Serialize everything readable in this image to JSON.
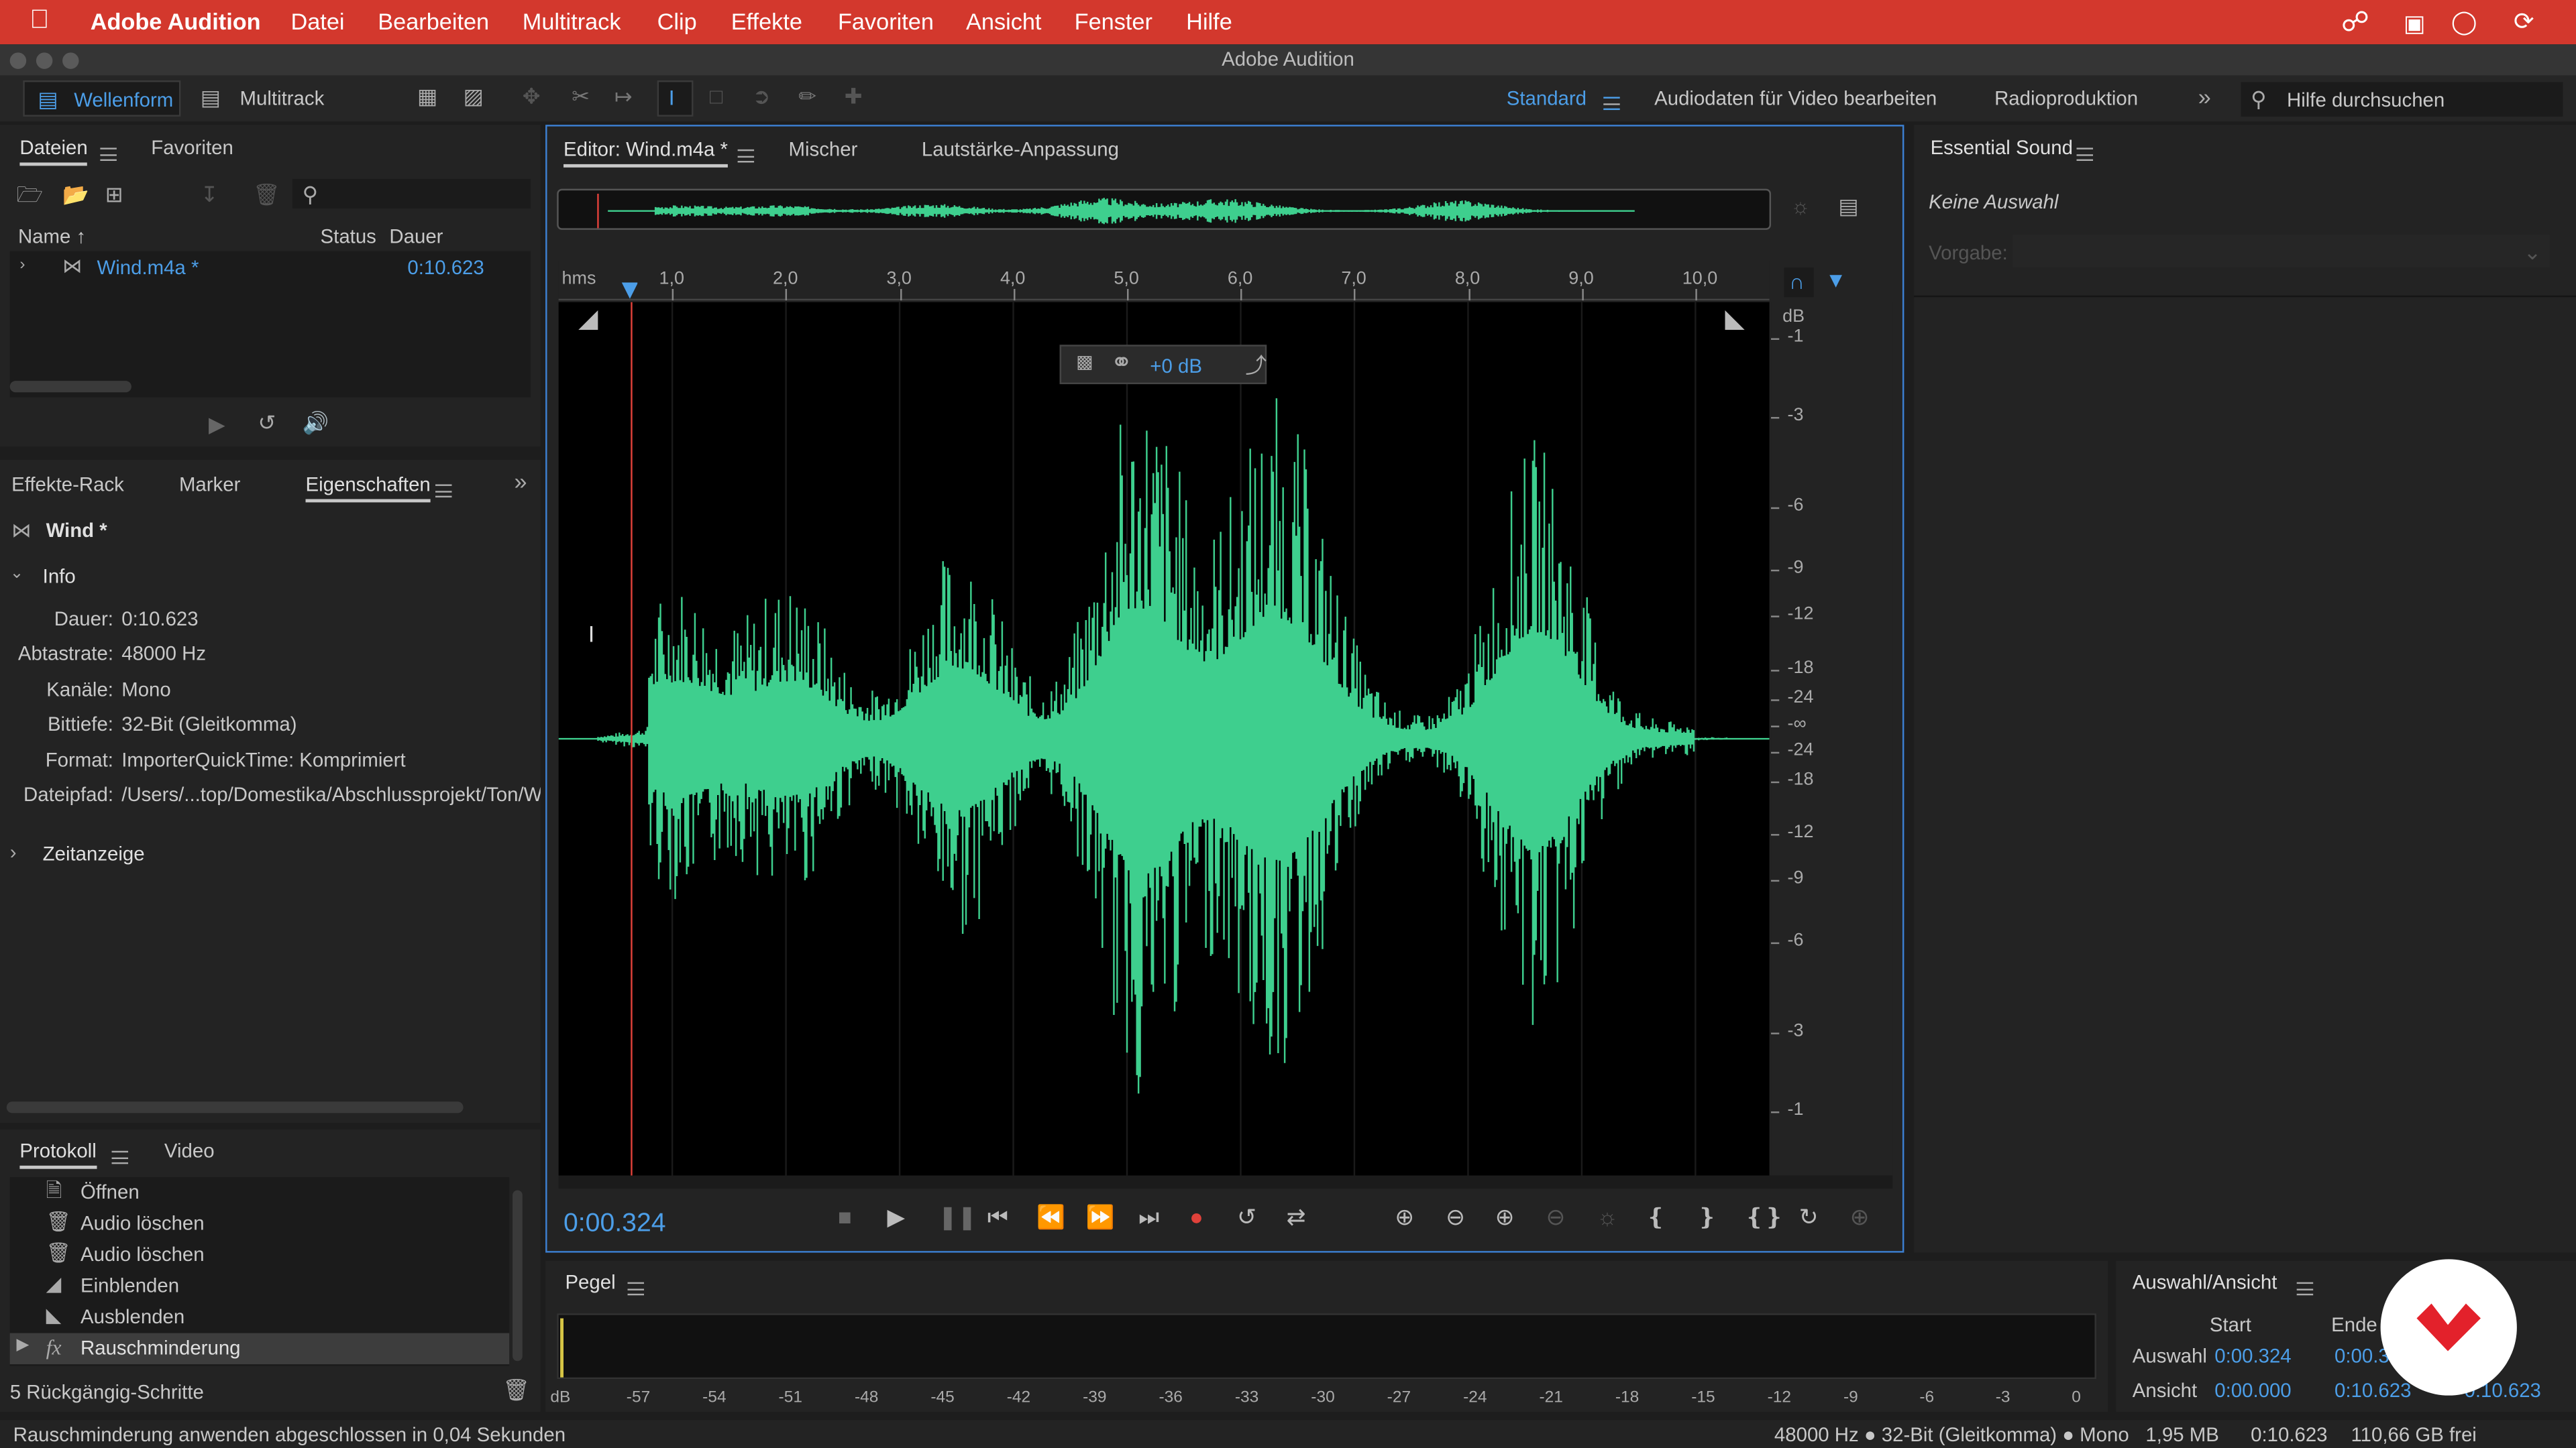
{
  "menubar": {
    "app_name": "Adobe Audition",
    "items": [
      "Datei",
      "Bearbeiten",
      "Multitrack",
      "Clip",
      "Effekte",
      "Favoriten",
      "Ansicht",
      "Fenster",
      "Hilfe"
    ]
  },
  "window": {
    "title": "Adobe Audition"
  },
  "toolbar": {
    "waveform_label": "Wellenform",
    "multitrack_label": "Multitrack",
    "workspaces": [
      "Standard",
      "Audiodaten für Video bearbeiten",
      "Radioproduktion"
    ],
    "search_placeholder": "Hilfe durchsuchen"
  },
  "files_panel": {
    "tabs": [
      "Dateien",
      "Favoriten"
    ],
    "columns": {
      "name": "Name ↑",
      "status": "Status",
      "duration": "Dauer"
    },
    "files": [
      {
        "name": "Wind.m4a *",
        "duration": "0:10.623"
      }
    ]
  },
  "properties_panel": {
    "tabs": [
      "Effekte-Rack",
      "Marker",
      "Eigenschaften"
    ],
    "file_title": "Wind *",
    "info_section": "Info",
    "info": [
      {
        "label": "Dauer:",
        "value": "0:10.623"
      },
      {
        "label": "Abtastrate:",
        "value": "48000 Hz"
      },
      {
        "label": "Kanäle:",
        "value": "Mono"
      },
      {
        "label": "Bittiefe:",
        "value": "32-Bit (Gleitkomma)"
      },
      {
        "label": "Format:",
        "value": "ImporterQuickTime: Komprimiert"
      },
      {
        "label": "Dateipfad:",
        "value": "/Users/...top/Domestika/Abschlussprojekt/Ton/Win"
      }
    ],
    "time_section": "Zeitanzeige"
  },
  "history_panel": {
    "tabs": [
      "Protokoll",
      "Video"
    ],
    "items": [
      {
        "icon": "open-icon",
        "label": "Öffnen"
      },
      {
        "icon": "trash-icon",
        "label": "Audio löschen"
      },
      {
        "icon": "trash-icon",
        "label": "Audio löschen"
      },
      {
        "icon": "fade-in-icon",
        "label": "Einblenden"
      },
      {
        "icon": "fade-out-icon",
        "label": "Ausblenden"
      },
      {
        "icon": "fx-icon",
        "label": "Rauschminderung"
      }
    ],
    "undo_steps": "5 Rückgängig-Schritte"
  },
  "editor": {
    "tabs": [
      "Editor: Wind.m4a *",
      "Mischer",
      "Lautstärke-Anpassung"
    ],
    "ruler_unit": "hms",
    "ruler_ticks": [
      "1,0",
      "2,0",
      "3,0",
      "4,0",
      "5,0",
      "6,0",
      "7,0",
      "8,0",
      "9,0",
      "10,0"
    ],
    "db_unit": "dB",
    "db_ticks": [
      "-1",
      "-3",
      "-6",
      "-9",
      "-12",
      "-18",
      "-24",
      "-∞",
      "-24",
      "-18",
      "-12",
      "-9",
      "-6",
      "-3",
      "-1"
    ],
    "hud_value": "+0 dB",
    "current_time": "0:00.324",
    "playhead_seconds": 0.324,
    "duration_seconds": 10.623,
    "waveform_color": "#3ecf8e"
  },
  "essential_sound": {
    "title": "Essential Sound",
    "no_selection": "Keine Auswahl",
    "preset_label": "Vorgabe:"
  },
  "level_panel": {
    "title": "Pegel",
    "scale": [
      "dB",
      "-57",
      "-54",
      "-51",
      "-48",
      "-45",
      "-42",
      "-39",
      "-36",
      "-33",
      "-30",
      "-27",
      "-24",
      "-21",
      "-18",
      "-15",
      "-12",
      "-9",
      "-6",
      "-3",
      "0"
    ]
  },
  "selection_panel": {
    "title": "Auswahl/Ansicht",
    "col_start": "Start",
    "col_end": "Ende",
    "row_selection": "Auswahl",
    "row_view": "Ansicht",
    "selection_start": "0:00.324",
    "selection_end": "0:00.324",
    "view_start": "0:00.000",
    "view_end": "0:10.623",
    "view_duration": "0:10.623"
  },
  "statusbar": {
    "message": "Rauschminderung anwenden abgeschlossen in 0,04 Sekunden",
    "format": "48000 Hz ● 32-Bit (Gleitkomma) ● Mono",
    "size": "1,95 MB",
    "duration": "0:10.623",
    "free": "110,66 GB frei"
  },
  "colors": {
    "accent": "#4c9ee8",
    "menubar": "#d3382d",
    "playhead": "#e0413a",
    "record": "#e0413a"
  }
}
